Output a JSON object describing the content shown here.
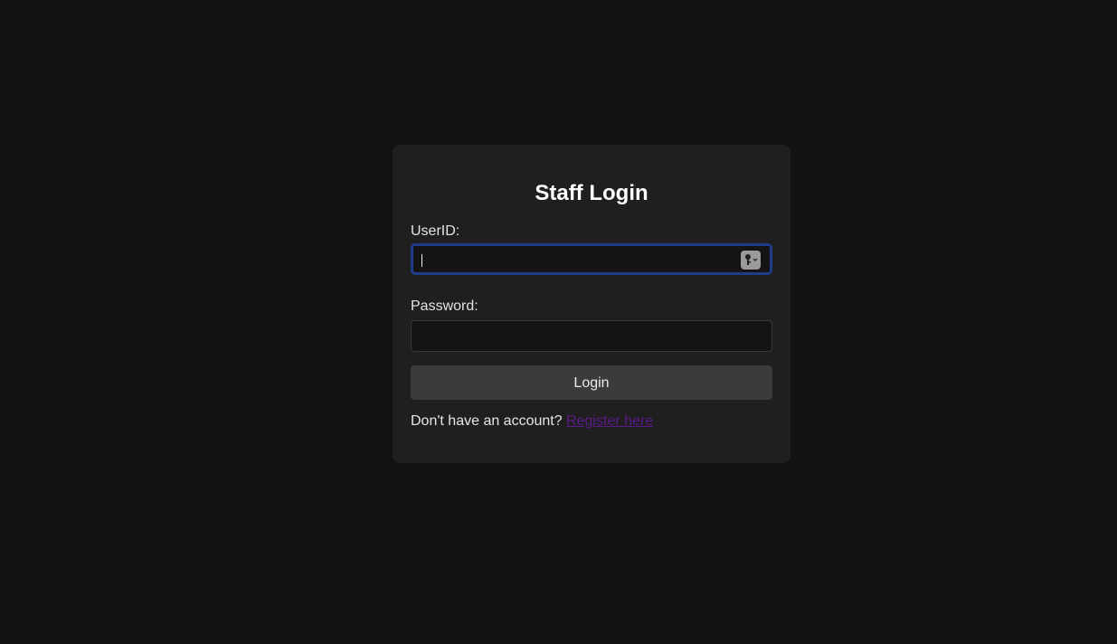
{
  "form": {
    "title": "Staff Login",
    "userid_label": "UserID:",
    "userid_value": "",
    "password_label": "Password:",
    "password_value": "",
    "login_label": "Login",
    "register_prompt": "Don't have an account?",
    "register_link": "Register here",
    "autofill_icon": "key-icon"
  },
  "colors": {
    "page_background": "#131313",
    "card_background": "#1f1f1f",
    "focus_border": "#1f3c8a",
    "button_background": "#3b3b3b",
    "link_color": "#5b1a8a"
  }
}
